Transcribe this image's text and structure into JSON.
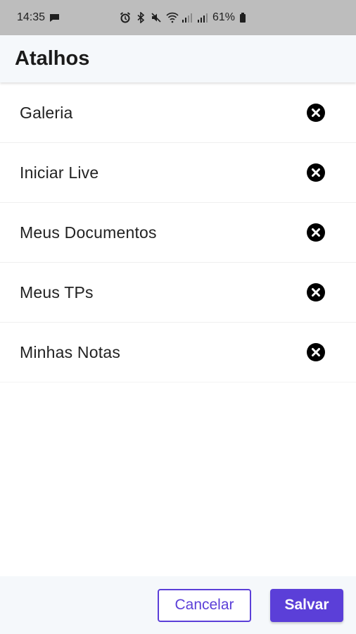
{
  "status_bar": {
    "time": "14:35",
    "battery": "61%",
    "icons": [
      "message-icon",
      "alarm-icon",
      "bluetooth-icon",
      "mute-icon",
      "wifi-icon",
      "signal-icon",
      "signal-icon",
      "battery-icon"
    ]
  },
  "header": {
    "title": "Atalhos"
  },
  "shortcuts": [
    {
      "label": "Galeria"
    },
    {
      "label": "Iniciar Live"
    },
    {
      "label": "Meus Documentos"
    },
    {
      "label": "Meus TPs"
    },
    {
      "label": "Minhas Notas"
    }
  ],
  "footer": {
    "cancel_label": "Cancelar",
    "save_label": "Salvar"
  },
  "colors": {
    "accent": "#5b3fd8",
    "status_bar_bg": "#bdbdbd",
    "surface": "#f5f8fb"
  }
}
